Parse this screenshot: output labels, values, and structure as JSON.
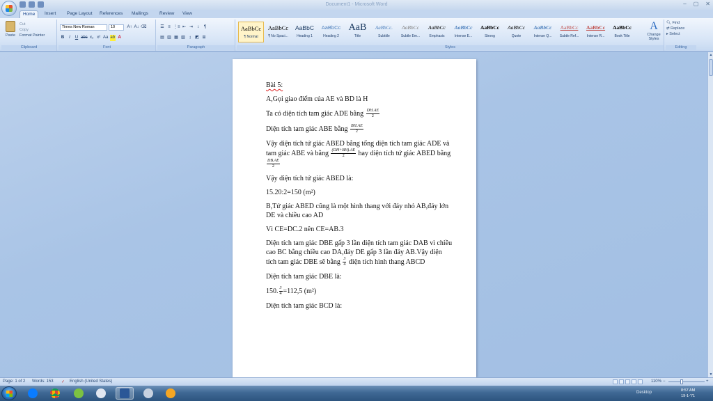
{
  "window": {
    "title": "Document1 - Microsoft Word"
  },
  "tabs": [
    "Home",
    "Insert",
    "Page Layout",
    "References",
    "Mailings",
    "Review",
    "View"
  ],
  "clipboard": {
    "paste": "Paste",
    "cut": "Cut",
    "copy": "Copy",
    "format_painter": "Format Painter",
    "label": "Clipboard"
  },
  "font": {
    "name": "Times New Roman",
    "size": "10",
    "label": "Font"
  },
  "paragraph": {
    "label": "Paragraph"
  },
  "styles": {
    "label": "Styles",
    "items": [
      {
        "preview": "AaBbCc",
        "name": "¶ Normal"
      },
      {
        "preview": "AaBbCc",
        "name": "¶ No Spaci..."
      },
      {
        "preview": "AaBbC",
        "name": "Heading 1"
      },
      {
        "preview": "AaBbCc",
        "name": "Heading 2"
      },
      {
        "preview": "AaB",
        "name": "Title"
      },
      {
        "preview": "AaBbCc.",
        "name": "Subtitle"
      },
      {
        "preview": "AaBbCc",
        "name": "Subtle Em..."
      },
      {
        "preview": "AaBbCc",
        "name": "Emphasis"
      },
      {
        "preview": "AaBbCc",
        "name": "Intense E..."
      },
      {
        "preview": "AaBbCc",
        "name": "Strong"
      },
      {
        "preview": "AaBbCc",
        "name": "Quote"
      },
      {
        "preview": "AaBbCc",
        "name": "Intense Q..."
      },
      {
        "preview": "AaBbCc",
        "name": "Subtle Ref..."
      },
      {
        "preview": "AaBbCc",
        "name": "Intense R..."
      },
      {
        "preview": "AaBbCc",
        "name": "Book Title"
      }
    ],
    "change_styles": "Change Styles"
  },
  "editing": {
    "find": "Find",
    "replace": "Replace",
    "select": "Select",
    "label": "Editing"
  },
  "document": {
    "l1": "Bài 5:",
    "l2": "A,Gọi giao điểm  của AE và BD là H",
    "l3": "Ta có diện tích tam giác ADE bằng",
    "f3n": "DH.AE",
    "f3d": "2",
    "l4": "Diện tích tam giác ABE bằng",
    "f4n": "BH.AE",
    "f4d": "2",
    "l5a": "Vậy diện tích tứ giác ABED bằng tổng diện tích tam giác ADE và tam giác ABE và bằng",
    "f5n": "(DH+BH).AE",
    "f5d": "2",
    "l5b": "hay diện tích tứ giác ABED bằng",
    "f6n": "DB.AE",
    "f6d": "2",
    "l6": "Vậy diện tích tứ giác ABED là:",
    "l7": "15.20:2=150 (m²)",
    "l8": "B,Tứ giác ABED cũng là một hình thang với đáy nhỏ AB,đáy lớn DE và chiều cao AD",
    "l9": "Vì CE=DC.2 nên CE=AB.3",
    "l10a": "Diện tích tam giác DBE gấp 3 lần diện tích tam giác DAB vì chiều cao BC bằng chiều cao DA,đáy DE gấp 3 lần đáy AB.Vậy diện tích tam giác DBE sẽ bằng",
    "f10n": "3",
    "f10d": "4",
    "l10b": "diện tích hình thang ABCD",
    "l11": "Diện tích tam giác DBE là:",
    "l12a": "150.",
    "f12n": "3",
    "f12d": "4",
    "l12b": "=112,5 (m²)",
    "l13": "Diện tích tam giác BCD là:"
  },
  "status": {
    "page": "Page: 1 of 2",
    "words": "Words: 153",
    "language": "English (United States)",
    "zoom": "110%"
  },
  "taskbar": {
    "apps": [
      "zalo-icon",
      "chrome-icon",
      "app-icon",
      "paint-icon",
      "word-icon",
      "tool-icon",
      "media-icon"
    ],
    "desktop": "Desktop",
    "time": "8:57 AM",
    "date": "19-1-'71"
  }
}
